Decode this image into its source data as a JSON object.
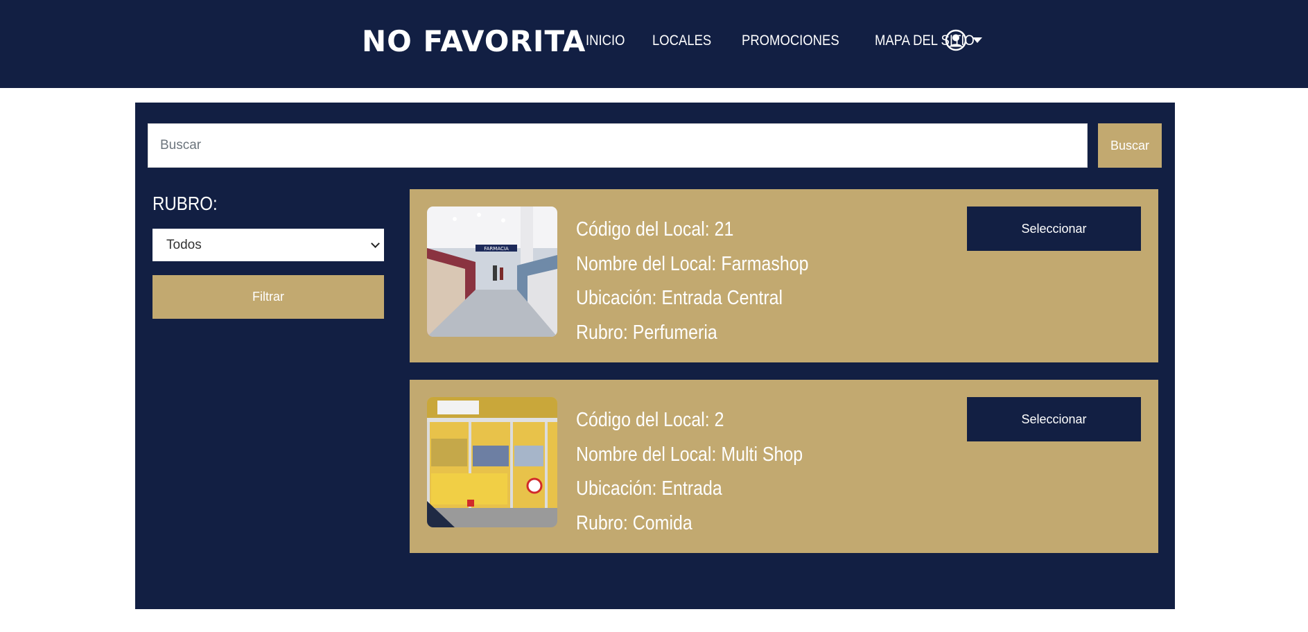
{
  "header": {
    "brand": "NO FAVORITA",
    "nav": [
      {
        "label": "INICIO"
      },
      {
        "label": "LOCALES"
      },
      {
        "label": "PROMOCIONES"
      },
      {
        "label": "MAPA DEL SITIO"
      }
    ],
    "user_icon": "user-circle-icon"
  },
  "search": {
    "placeholder": "Buscar",
    "button_label": "Buscar"
  },
  "filter": {
    "label": "RUBRO:",
    "selected": "Todos",
    "button_label": "Filtrar"
  },
  "stores": [
    {
      "code_label": "Código del Local: ",
      "code": "21",
      "name_label": "Nombre del Local: ",
      "name": "Farmashop",
      "location_label": "Ubicación: ",
      "location": "Entrada Central",
      "category_label": "Rubro: ",
      "category": "Perfumeria",
      "button_label": "Seleccionar",
      "photo_sign": "FARMACIA"
    },
    {
      "code_label": "Código del Local: ",
      "code": "2",
      "name_label": "Nombre del Local: ",
      "name": "Multi Shop",
      "location_label": "Ubicación: ",
      "location": "Entrada",
      "category_label": "Rubro: ",
      "category": "Comida",
      "button_label": "Seleccionar"
    }
  ],
  "colors": {
    "navy": "#121f43",
    "gold": "#c2a970"
  }
}
